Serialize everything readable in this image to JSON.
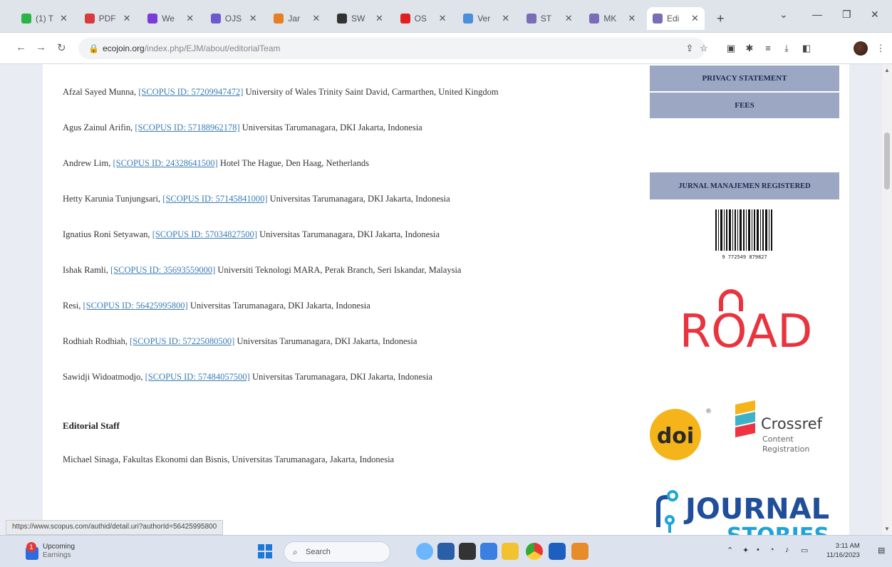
{
  "browser": {
    "tabs": [
      {
        "label": "(1) T",
        "color": "#28b446"
      },
      {
        "label": "PDF",
        "color": "#d83b3b"
      },
      {
        "label": "We",
        "color": "#7a3bd8"
      },
      {
        "label": "OJS",
        "color": "#6a5acd"
      },
      {
        "label": "Jar",
        "color": "#e67e22"
      },
      {
        "label": "SW",
        "color": "#333333"
      },
      {
        "label": "OS",
        "color": "#e02020"
      },
      {
        "label": "Ver",
        "color": "#4a8fd8"
      },
      {
        "label": "ST",
        "color": "#7b6cb8"
      },
      {
        "label": "MK",
        "color": "#7b6cb8"
      },
      {
        "label": "Edi",
        "color": "#7b6cb8"
      }
    ],
    "url_host": "ecojoin.org",
    "url_path": "/index.php/EJM/about/editorialTeam"
  },
  "members": [
    {
      "name": "Afzal Sayed Munna,",
      "scopus": "[SCOPUS ID: 57209947472]",
      "affiliation": "University of Wales Trinity Saint David, Carmarthen, United Kingdom"
    },
    {
      "name": "Agus Zainul Arifin,",
      "scopus": "[SCOPUS ID: 57188962178]",
      "affiliation": "Universitas Tarumanagara, DKI Jakarta, Indonesia"
    },
    {
      "name": "Andrew Lim,",
      "scopus": "[SCOPUS ID: 24328641500]",
      "affiliation": "Hotel The Hague, Den Haag, Netherlands"
    },
    {
      "name": "Hetty Karunia Tunjungsari,",
      "scopus": "[SCOPUS ID: 57145841000]",
      "affiliation": "Universitas Tarumanagara, DKI Jakarta, Indonesia"
    },
    {
      "name": "Ignatius Roni Setyawan,",
      "scopus": "[SCOPUS ID: 57034827500]",
      "affiliation": "Universitas Tarumanagara, DKI Jakarta, Indonesia"
    },
    {
      "name": "Ishak Ramli,",
      "scopus": "[SCOPUS ID: 35693559000]",
      "affiliation": "Universiti Teknologi MARA, Perak Branch, Seri Iskandar, Malaysia"
    },
    {
      "name": "Resi,",
      "scopus": "[SCOPUS ID: 56425995800]",
      "affiliation": "Universitas Tarumanagara, DKI Jakarta, Indonesia"
    },
    {
      "name": "Rodhiah Rodhiah,",
      "scopus": "[SCOPUS ID: 57225080500]",
      "affiliation": "Universitas Tarumanagara, DKI Jakarta, Indonesia"
    },
    {
      "name": "Sawidji Widoatmodjo,",
      "scopus": "[SCOPUS ID: 57484057500]",
      "affiliation": "Universitas Tarumanagara, DKI Jakarta, Indonesia"
    }
  ],
  "editorial_staff": {
    "title": "Editorial Staff",
    "member": "Michael Sinaga, Fakultas Ekonomi dan Bisnis, Universitas Tarumanagara, Jakarta, Indonesia"
  },
  "sidebar": {
    "privacy": "PRIVACY STATEMENT",
    "fees": "FEES",
    "registered": "JURNAL MANAJEMEN REGISTERED",
    "barcode_number": "9 772549 879827",
    "road_text": "ROAD",
    "crossref": "Crossref",
    "crossref_sub1": "Content",
    "crossref_sub2": "Registration",
    "doi_text": "doi",
    "journal_text": "JOURNAL",
    "stories_text": "STORIES"
  },
  "status_url": "https://www.scopus.com/authid/detail.uri?authorId=56425995800",
  "taskbar": {
    "weather_title": "Upcoming",
    "weather_sub": "Earnings",
    "weather_badge": "1",
    "search": "Search",
    "time": "3:11 AM",
    "date": "11/16/2023"
  }
}
